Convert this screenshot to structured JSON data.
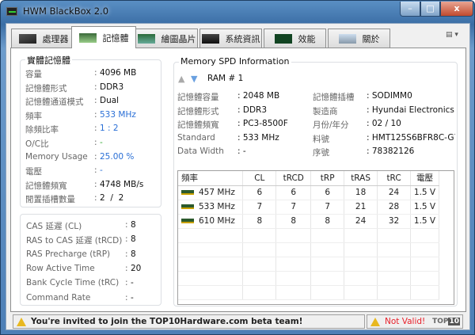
{
  "window": {
    "title": "HWM BlackBox 2.0",
    "min": "–",
    "max": "□",
    "close": "x"
  },
  "tabs": [
    {
      "label": "處理器",
      "icon": "cpu-icon"
    },
    {
      "label": "記憶體",
      "icon": "memory-icon"
    },
    {
      "label": "繪圖晶片",
      "icon": "gpu-icon"
    },
    {
      "label": "系統資訊",
      "icon": "system-icon"
    },
    {
      "label": "效能",
      "icon": "performance-icon"
    },
    {
      "label": "關於",
      "icon": "about-icon"
    }
  ],
  "physical": {
    "title": "實體記憶體",
    "rows": [
      {
        "label": "容量",
        "value": "4096 MB",
        "color": "#111"
      },
      {
        "label": "記憶體形式",
        "value": "DDR3",
        "color": "#111"
      },
      {
        "label": "記憶體通道模式",
        "value": "Dual",
        "color": "#111"
      },
      {
        "label": "頻率",
        "value": "533 MHz",
        "color": "#2a6fd6"
      },
      {
        "label": "除頻比率",
        "value": "1 : 2",
        "color": "#2a6fd6"
      },
      {
        "label": "O/C比",
        "value": "-",
        "color": "#33aa33"
      },
      {
        "label": "Memory Usage",
        "value": "25.00 %",
        "color": "#2a6fd6"
      },
      {
        "label": "電壓",
        "value": "-",
        "color": "#2a6fd6"
      },
      {
        "label": "記憶體頻寬",
        "value": "4748 MB/s",
        "color": "#111"
      },
      {
        "label": "閒置插槽數量",
        "value": "2  /  2",
        "color": "#111"
      }
    ]
  },
  "timings": {
    "rows": [
      {
        "label": "CAS 延遲 (CL)",
        "value": "8"
      },
      {
        "label": "RAS to CAS 延遲 (tRCD)",
        "value": "8"
      },
      {
        "label": "RAS Precharge (tRP)",
        "value": "8"
      },
      {
        "label": "Row Active Time",
        "value": "20"
      },
      {
        "label": "Bank Cycle Time (tRC)",
        "value": "-"
      },
      {
        "label": "Command Rate",
        "value": "-"
      }
    ]
  },
  "spd": {
    "title": "Memory SPD Information",
    "ram_label": "RAM # 1",
    "left": [
      {
        "label": "記憶體容量",
        "value": "2048 MB"
      },
      {
        "label": "記憶體形式",
        "value": "DDR3"
      },
      {
        "label": "記憶體頻寬",
        "value": "PC3-8500F"
      },
      {
        "label": "Standard",
        "value": "533 MHz"
      },
      {
        "label": "Data Width",
        "value": "-"
      }
    ],
    "right": [
      {
        "label": "記憶體插槽",
        "value": "SODIMM0"
      },
      {
        "label": "製造商",
        "value": "Hyundai Electronics"
      },
      {
        "label": "月份/年分",
        "value": "02 / 10"
      },
      {
        "label": "料號",
        "value": "HMT125S6BFR8C-G7"
      },
      {
        "label": "序號",
        "value": "78382126"
      }
    ],
    "table": {
      "headers": [
        "頻率",
        "CL",
        "tRCD",
        "tRP",
        "tRAS",
        "tRC",
        "電壓"
      ],
      "rows": [
        [
          "457 MHz",
          "6",
          "6",
          "6",
          "18",
          "24",
          "1.5 V"
        ],
        [
          "533 MHz",
          "7",
          "7",
          "7",
          "21",
          "28",
          "1.5 V"
        ],
        [
          "610 MHz",
          "8",
          "8",
          "8",
          "24",
          "32",
          "1.5 V"
        ]
      ]
    }
  },
  "status": {
    "message": "You're invited to join the TOP10Hardware.com beta team!",
    "validity": "Not Valid!",
    "logo": "TOP10"
  }
}
